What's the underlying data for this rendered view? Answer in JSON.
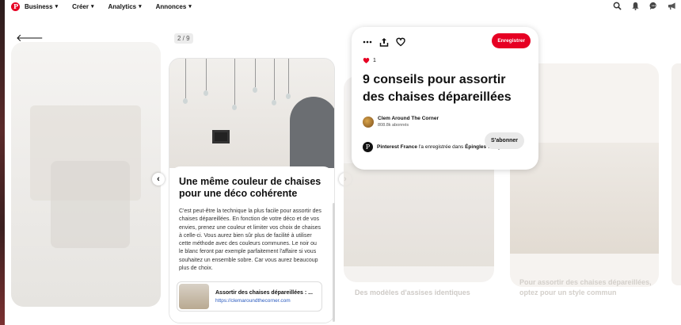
{
  "topnav": {
    "items": [
      {
        "label": "Business"
      },
      {
        "label": "Créer"
      },
      {
        "label": "Analytics"
      },
      {
        "label": "Annonces"
      }
    ]
  },
  "viewer": {
    "page_indicator": "2 / 9"
  },
  "pin": {
    "save_label": "Enregistrer",
    "likes_count": "1",
    "title": "9 conseils pour assortir des chaises dépareillées",
    "author_name": "Clem Around The Corner",
    "author_subs": "808.8k abonnés",
    "follow_label": "S'abonner",
    "saved_by": "Pinterest France",
    "saved_text": " l'a enregistrée dans ",
    "board": "Épingles Story"
  },
  "story_page": {
    "title": "Une même couleur de chaises pour une déco cohérente",
    "body": "C'est peut-être la technique la plus facile pour assortir des chaises dépareillées. En fonction de votre déco et de vos envies, prenez une couleur et limiter vos choix de chaises à celle-ci. Vous aurez bien sûr plus de facilité à utiliser cette méthode avec des couleurs communes. Le noir ou le blanc feront par exemple parfaitement l'affaire si vous souhaitez un ensemble sobre. Car vous aurez beaucoup plus de choix.",
    "link_title": "Assortir des chaises dépareillées : ...",
    "link_url": "https://clemaroundthecorner.com"
  },
  "next_pages": [
    {
      "caption": "Des modèles d'assises identiques"
    },
    {
      "caption": "Pour assortir des chaises dépareillées, optez pour un style commun"
    }
  ],
  "colors": {
    "accent": "#e60023"
  }
}
